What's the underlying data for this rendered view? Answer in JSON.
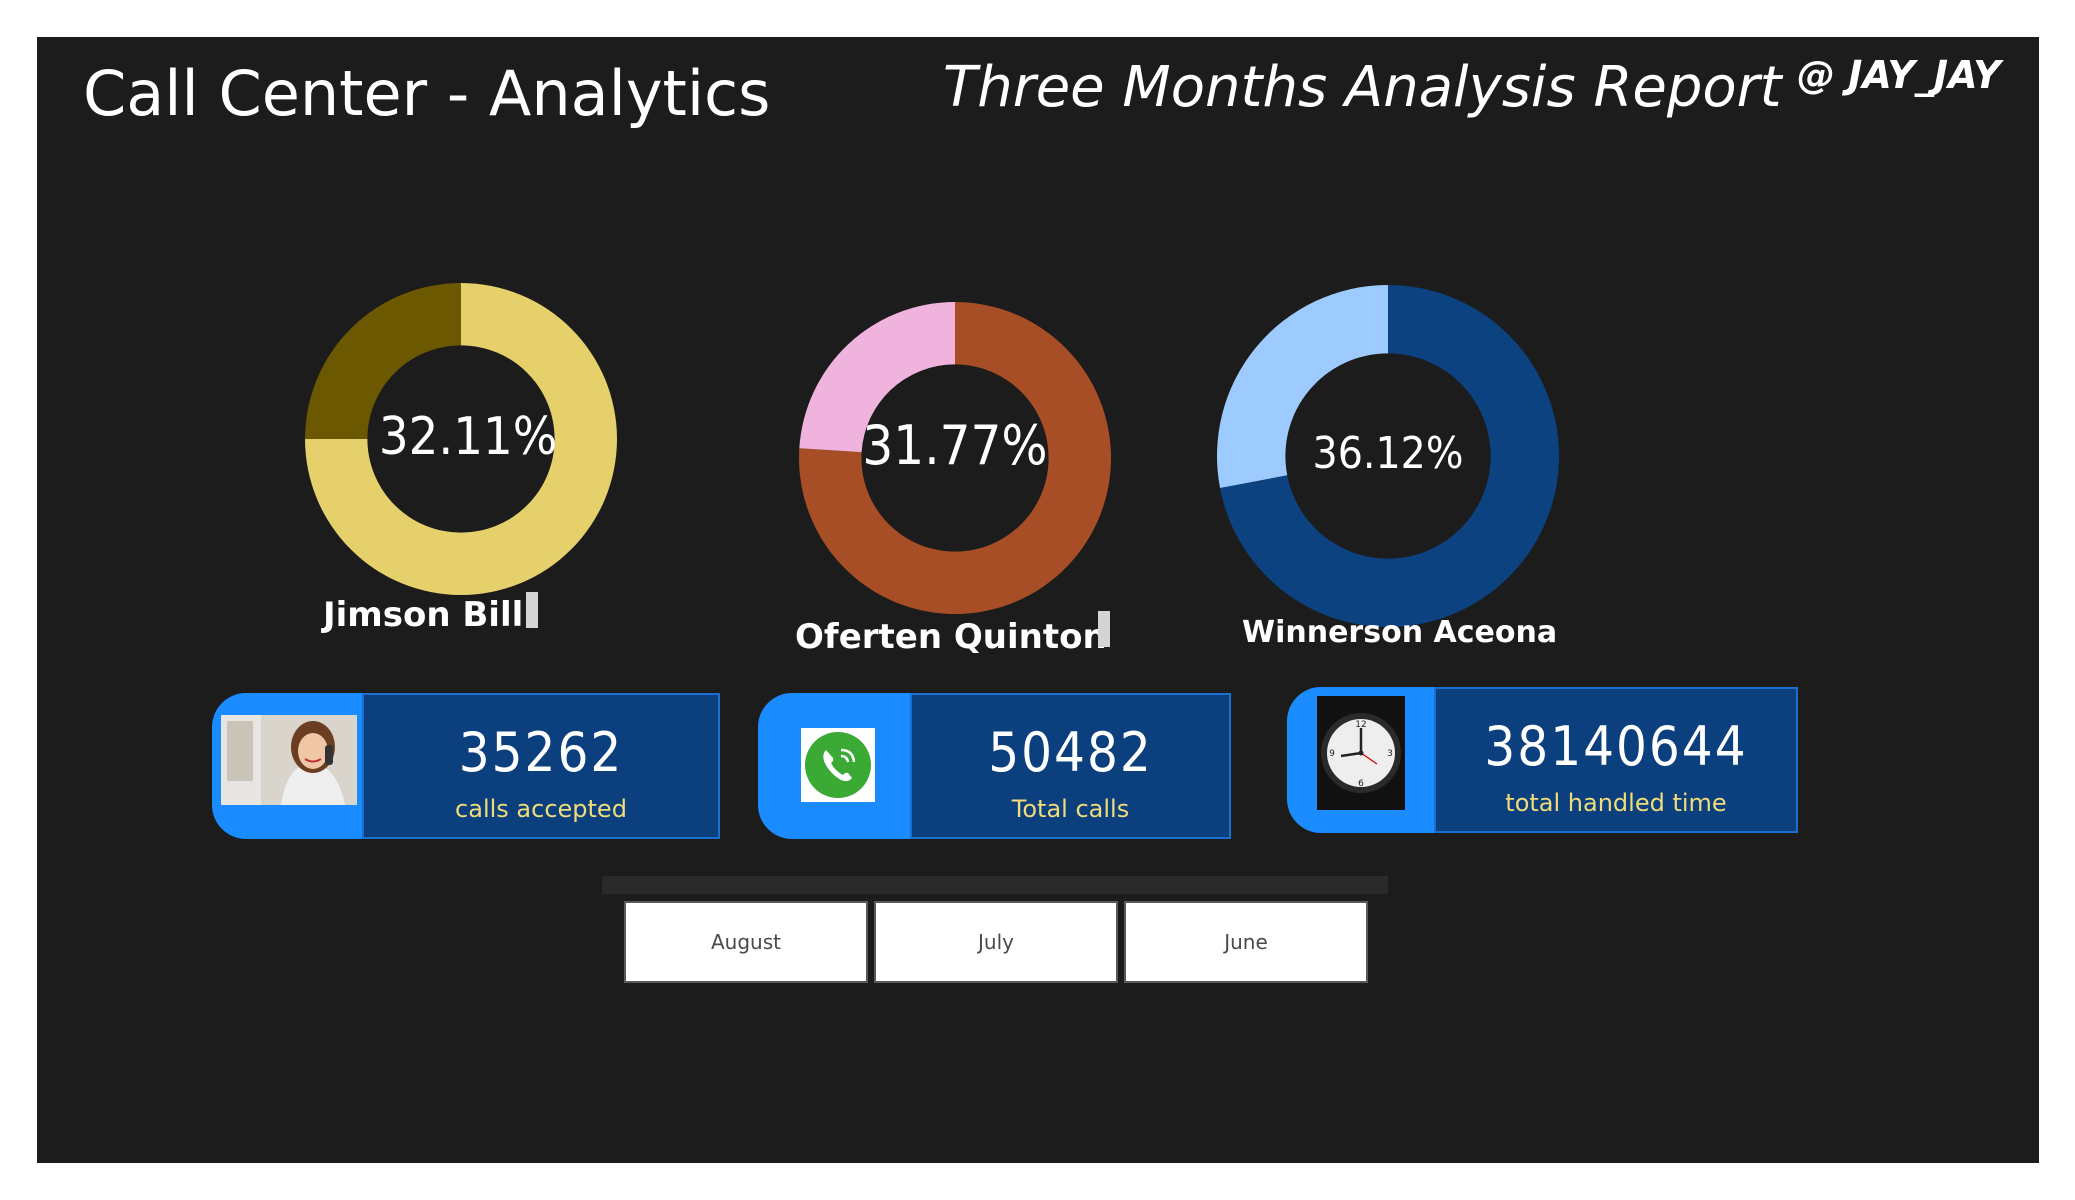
{
  "header": {
    "title": "Call Center - Analytics",
    "subtitle": "Three Months Analysis Report",
    "author": "@ JAY_JAY"
  },
  "chart_data": [
    {
      "type": "pie",
      "variant": "donut",
      "name": "Jimson Bill",
      "center_label": "32.11%",
      "values": [
        75,
        25
      ],
      "colors": [
        "#e6d06b",
        "#6b5800"
      ]
    },
    {
      "type": "pie",
      "variant": "donut",
      "name": "Oferten Quinton",
      "center_label": "31.77%",
      "values": [
        76,
        24
      ],
      "colors": [
        "#a84e26",
        "#f0b3de"
      ]
    },
    {
      "type": "pie",
      "variant": "donut",
      "name": "Winnerson Aceona",
      "center_label": "36.12%",
      "values": [
        72,
        28
      ],
      "colors": [
        "#0b427f",
        "#9ecbff"
      ]
    }
  ],
  "kpis": [
    {
      "value": "35262",
      "label": "calls accepted",
      "icon": "person-on-phone-icon"
    },
    {
      "value": "50482",
      "label": "Total calls",
      "icon": "phone-call-icon"
    },
    {
      "value": "38140644",
      "label": "total handled time",
      "icon": "clock-icon"
    }
  ],
  "months": [
    "August",
    "July",
    "June"
  ],
  "colors": {
    "background": "#1c1c1c",
    "kpi_accent": "#1b8cff",
    "kpi_panel": "#0b3f7e",
    "kpi_label": "#f0dc7a"
  }
}
